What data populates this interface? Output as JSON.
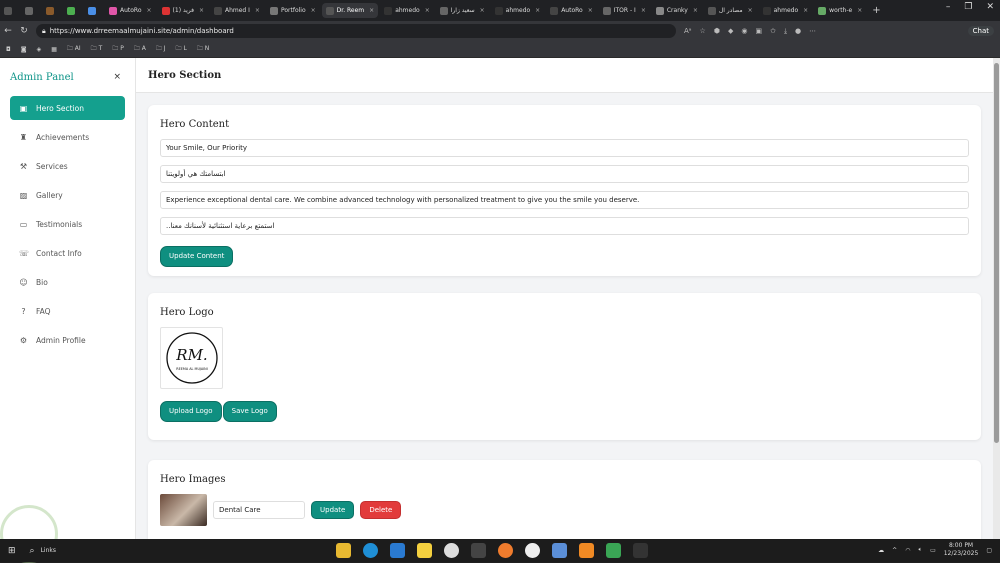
{
  "browser": {
    "tabs": [
      {
        "label": ""
      },
      {
        "label": ""
      },
      {
        "label": ""
      },
      {
        "label": ""
      },
      {
        "label": ""
      },
      {
        "label": "AutoRo"
      },
      {
        "label": "(1) فريد"
      },
      {
        "label": "Ahmed I"
      },
      {
        "label": "Portfolio"
      },
      {
        "label": "Dr. Reem",
        "active": true
      },
      {
        "label": "ahmedo"
      },
      {
        "label": "سعيد زارا"
      },
      {
        "label": "ahmedo"
      },
      {
        "label": "AutoRo"
      },
      {
        "label": "ITOR - I"
      },
      {
        "label": "Cranky"
      },
      {
        "label": "مصادر ال"
      },
      {
        "label": "ahmedo"
      },
      {
        "label": "worth-e"
      }
    ],
    "url": "https://www.drreemaalmujaini.site/admin/dashboard",
    "chat_label": "Chat",
    "bookmarks": [
      "AI",
      "T",
      "P",
      "A",
      "J",
      "L",
      "N"
    ]
  },
  "sidebar": {
    "title": "Admin Panel",
    "close": "×",
    "items": [
      {
        "label": "Hero Section",
        "icon": "image-icon",
        "active": true
      },
      {
        "label": "Achievements",
        "icon": "trophy-icon"
      },
      {
        "label": "Services",
        "icon": "wrench-icon"
      },
      {
        "label": "Gallery",
        "icon": "gallery-icon"
      },
      {
        "label": "Testimonials",
        "icon": "message-icon"
      },
      {
        "label": "Contact Info",
        "icon": "phone-icon"
      },
      {
        "label": "Bio",
        "icon": "user-icon"
      },
      {
        "label": "FAQ",
        "icon": "help-icon"
      },
      {
        "label": "Admin Profile",
        "icon": "gear-icon"
      }
    ]
  },
  "header": {
    "title": "Hero Section"
  },
  "hero_content": {
    "title": "Hero Content",
    "fields": [
      "Your Smile, Our Priority",
      "ابتسامتك هي أولويتنا",
      "Experience exceptional dental care. We combine advanced technology with personalized treatment to give you the smile you deserve.",
      "استمتع برعاية استثنائية لأسنانك معنا.."
    ],
    "update_label": "Update Content"
  },
  "hero_logo": {
    "title": "Hero Logo",
    "logo_initials": "RM.",
    "logo_text": "REEMA AL MUJAINI",
    "upload_label": "Upload Logo",
    "save_label": "Save Logo"
  },
  "hero_images": {
    "title": "Hero Images",
    "rows": [
      {
        "caption": "Dental Care",
        "update_label": "Update",
        "delete_label": "Delete"
      }
    ]
  },
  "taskbar": {
    "search_label": "Links",
    "time": "8:00 PM",
    "date": "12/23/2025"
  },
  "colors": {
    "accent": "#0d9488",
    "button": "#0f8f80",
    "danger": "#e23b3b"
  }
}
